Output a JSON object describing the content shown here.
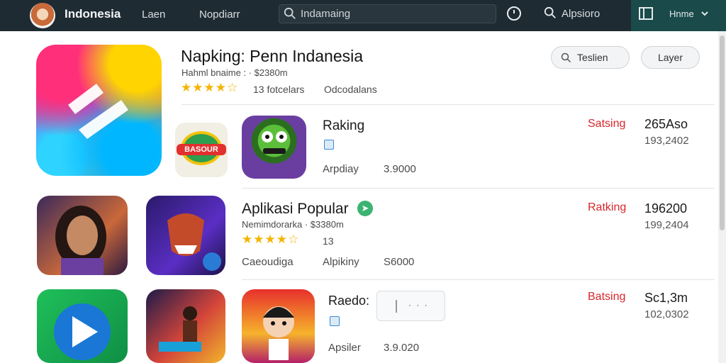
{
  "topbar": {
    "brand": "Indonesia",
    "nav": [
      "Laen",
      "Nopdiarr"
    ],
    "search_text": "Indamaing",
    "search2_text": "Alpsioro",
    "home_text": "Hnme"
  },
  "header": {
    "title": "Napking: Penn Indanesia",
    "subtitle": "Hahml bnaime : · $2380m",
    "stars": "★★★★☆",
    "reviews": "13 fotcelars",
    "downloads": "Odcodalans",
    "btn_search": "Teslien",
    "btn_layer": "Layer"
  },
  "rows": [
    {
      "title": "Raking",
      "meta_left": "Arpdiay",
      "meta_right": "3.9000",
      "rank_label": "Satsing",
      "big": "265Aso",
      "small": "193,2402",
      "logo_text": "BASOUR"
    },
    {
      "title": "Aplikasi Popular",
      "subtitle": "Nemimdorarka · $3380m",
      "stars": "★★★★☆",
      "reviews": "13",
      "meta_a": "Caeoudiga",
      "meta_b": "Alpikiny",
      "meta_c": "S6000",
      "rank_label": "Ratking",
      "big": "196200",
      "small": "199,2404",
      "verify": "➤"
    },
    {
      "title": "Raedo:",
      "meta_left": "Apsiler",
      "meta_right": "3.9.020",
      "rank_label": "Batsing",
      "big": "Sc1,3m",
      "small": "102,0302",
      "mini_text": "· · ·"
    }
  ],
  "colors": {
    "topbar_bg": "#1f2b33",
    "accent_red": "#d6262c",
    "star": "#f4b400"
  }
}
